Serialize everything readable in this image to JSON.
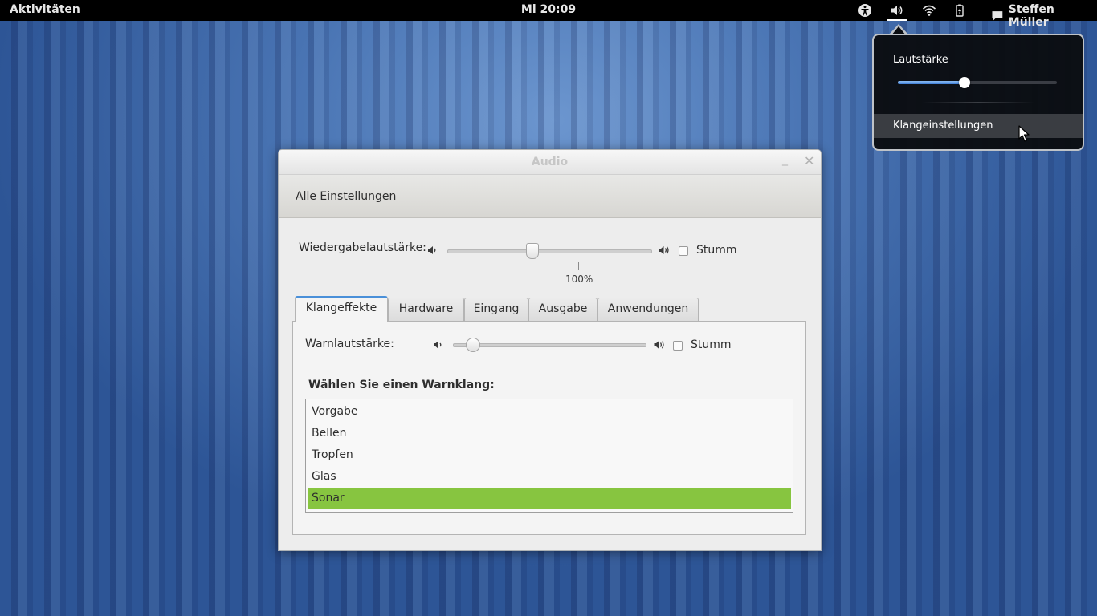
{
  "topbar": {
    "activities": "Aktivitäten",
    "clock": "Mi 20:09",
    "user_name": "Steffen Müller",
    "icons": [
      "accessibility-icon",
      "volume-icon",
      "wifi-icon",
      "battery-icon",
      "chat-icon"
    ]
  },
  "popup": {
    "title": "Lautstärke",
    "volume_level": 0.42,
    "menu_item": "Klangeinstellungen"
  },
  "window": {
    "title": "Audio",
    "toolbar_button": "Alle Einstellungen",
    "playback": {
      "label": "Wiedergabelautstärke:",
      "mute_label": "Stumm",
      "percent_label": "100%",
      "level": 0.42,
      "mute_checked": false
    },
    "tabs": [
      {
        "label": "Klangeffekte",
        "active": true
      },
      {
        "label": "Hardware",
        "active": false
      },
      {
        "label": "Eingang",
        "active": false
      },
      {
        "label": "Ausgabe",
        "active": false
      },
      {
        "label": "Anwendungen",
        "active": false
      }
    ],
    "alert": {
      "label": "Warnlautstärke:",
      "mute_label": "Stumm",
      "level": 0.1,
      "mute_checked": false
    },
    "choose_label": "Wählen Sie einen Warnklang:",
    "sounds": [
      {
        "label": "Vorgabe",
        "selected": false
      },
      {
        "label": "Bellen",
        "selected": false
      },
      {
        "label": "Tropfen",
        "selected": false
      },
      {
        "label": "Glas",
        "selected": false
      },
      {
        "label": "Sonar",
        "selected": true
      }
    ]
  },
  "colors": {
    "accent_blue": "#4a90d9",
    "selection_green": "#87c540",
    "topbar_bg": "#000000"
  }
}
